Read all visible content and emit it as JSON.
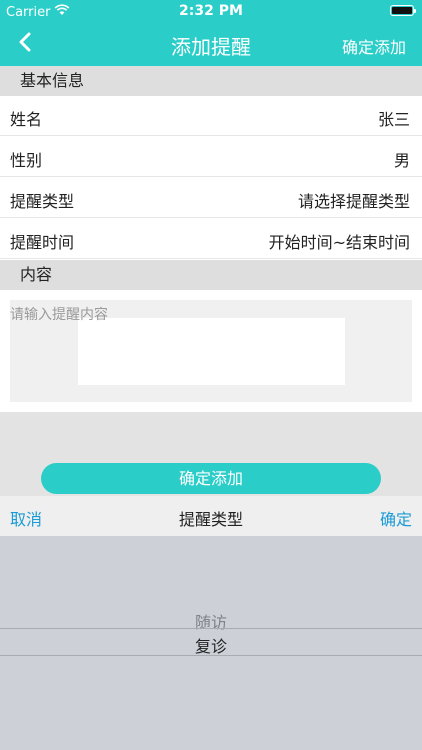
{
  "status_bar": {
    "carrier": "Carrier",
    "time": "2:32 PM",
    "battery_level": 1.0
  },
  "nav": {
    "title": "添加提醒",
    "action": "确定添加",
    "back_icon": "chevron-left-icon"
  },
  "sections": {
    "basic_info": "基本信息",
    "content": "内容"
  },
  "rows": [
    {
      "label": "姓名",
      "value": "张三"
    },
    {
      "label": "性别",
      "value": "男"
    },
    {
      "label": "提醒类型",
      "value": "请选择提醒类型"
    },
    {
      "label": "提醒时间",
      "value": "开始时间~结束时间"
    }
  ],
  "content_input": {
    "placeholder": "请输入提醒内容",
    "value": ""
  },
  "confirm_button": "确定添加",
  "picker": {
    "cancel": "取消",
    "title": "提醒类型",
    "done": "确定",
    "options": [
      "随访",
      "复诊"
    ],
    "selected": "复诊"
  },
  "colors": {
    "accent": "#2acdc8",
    "link": "#1a9bd6"
  }
}
